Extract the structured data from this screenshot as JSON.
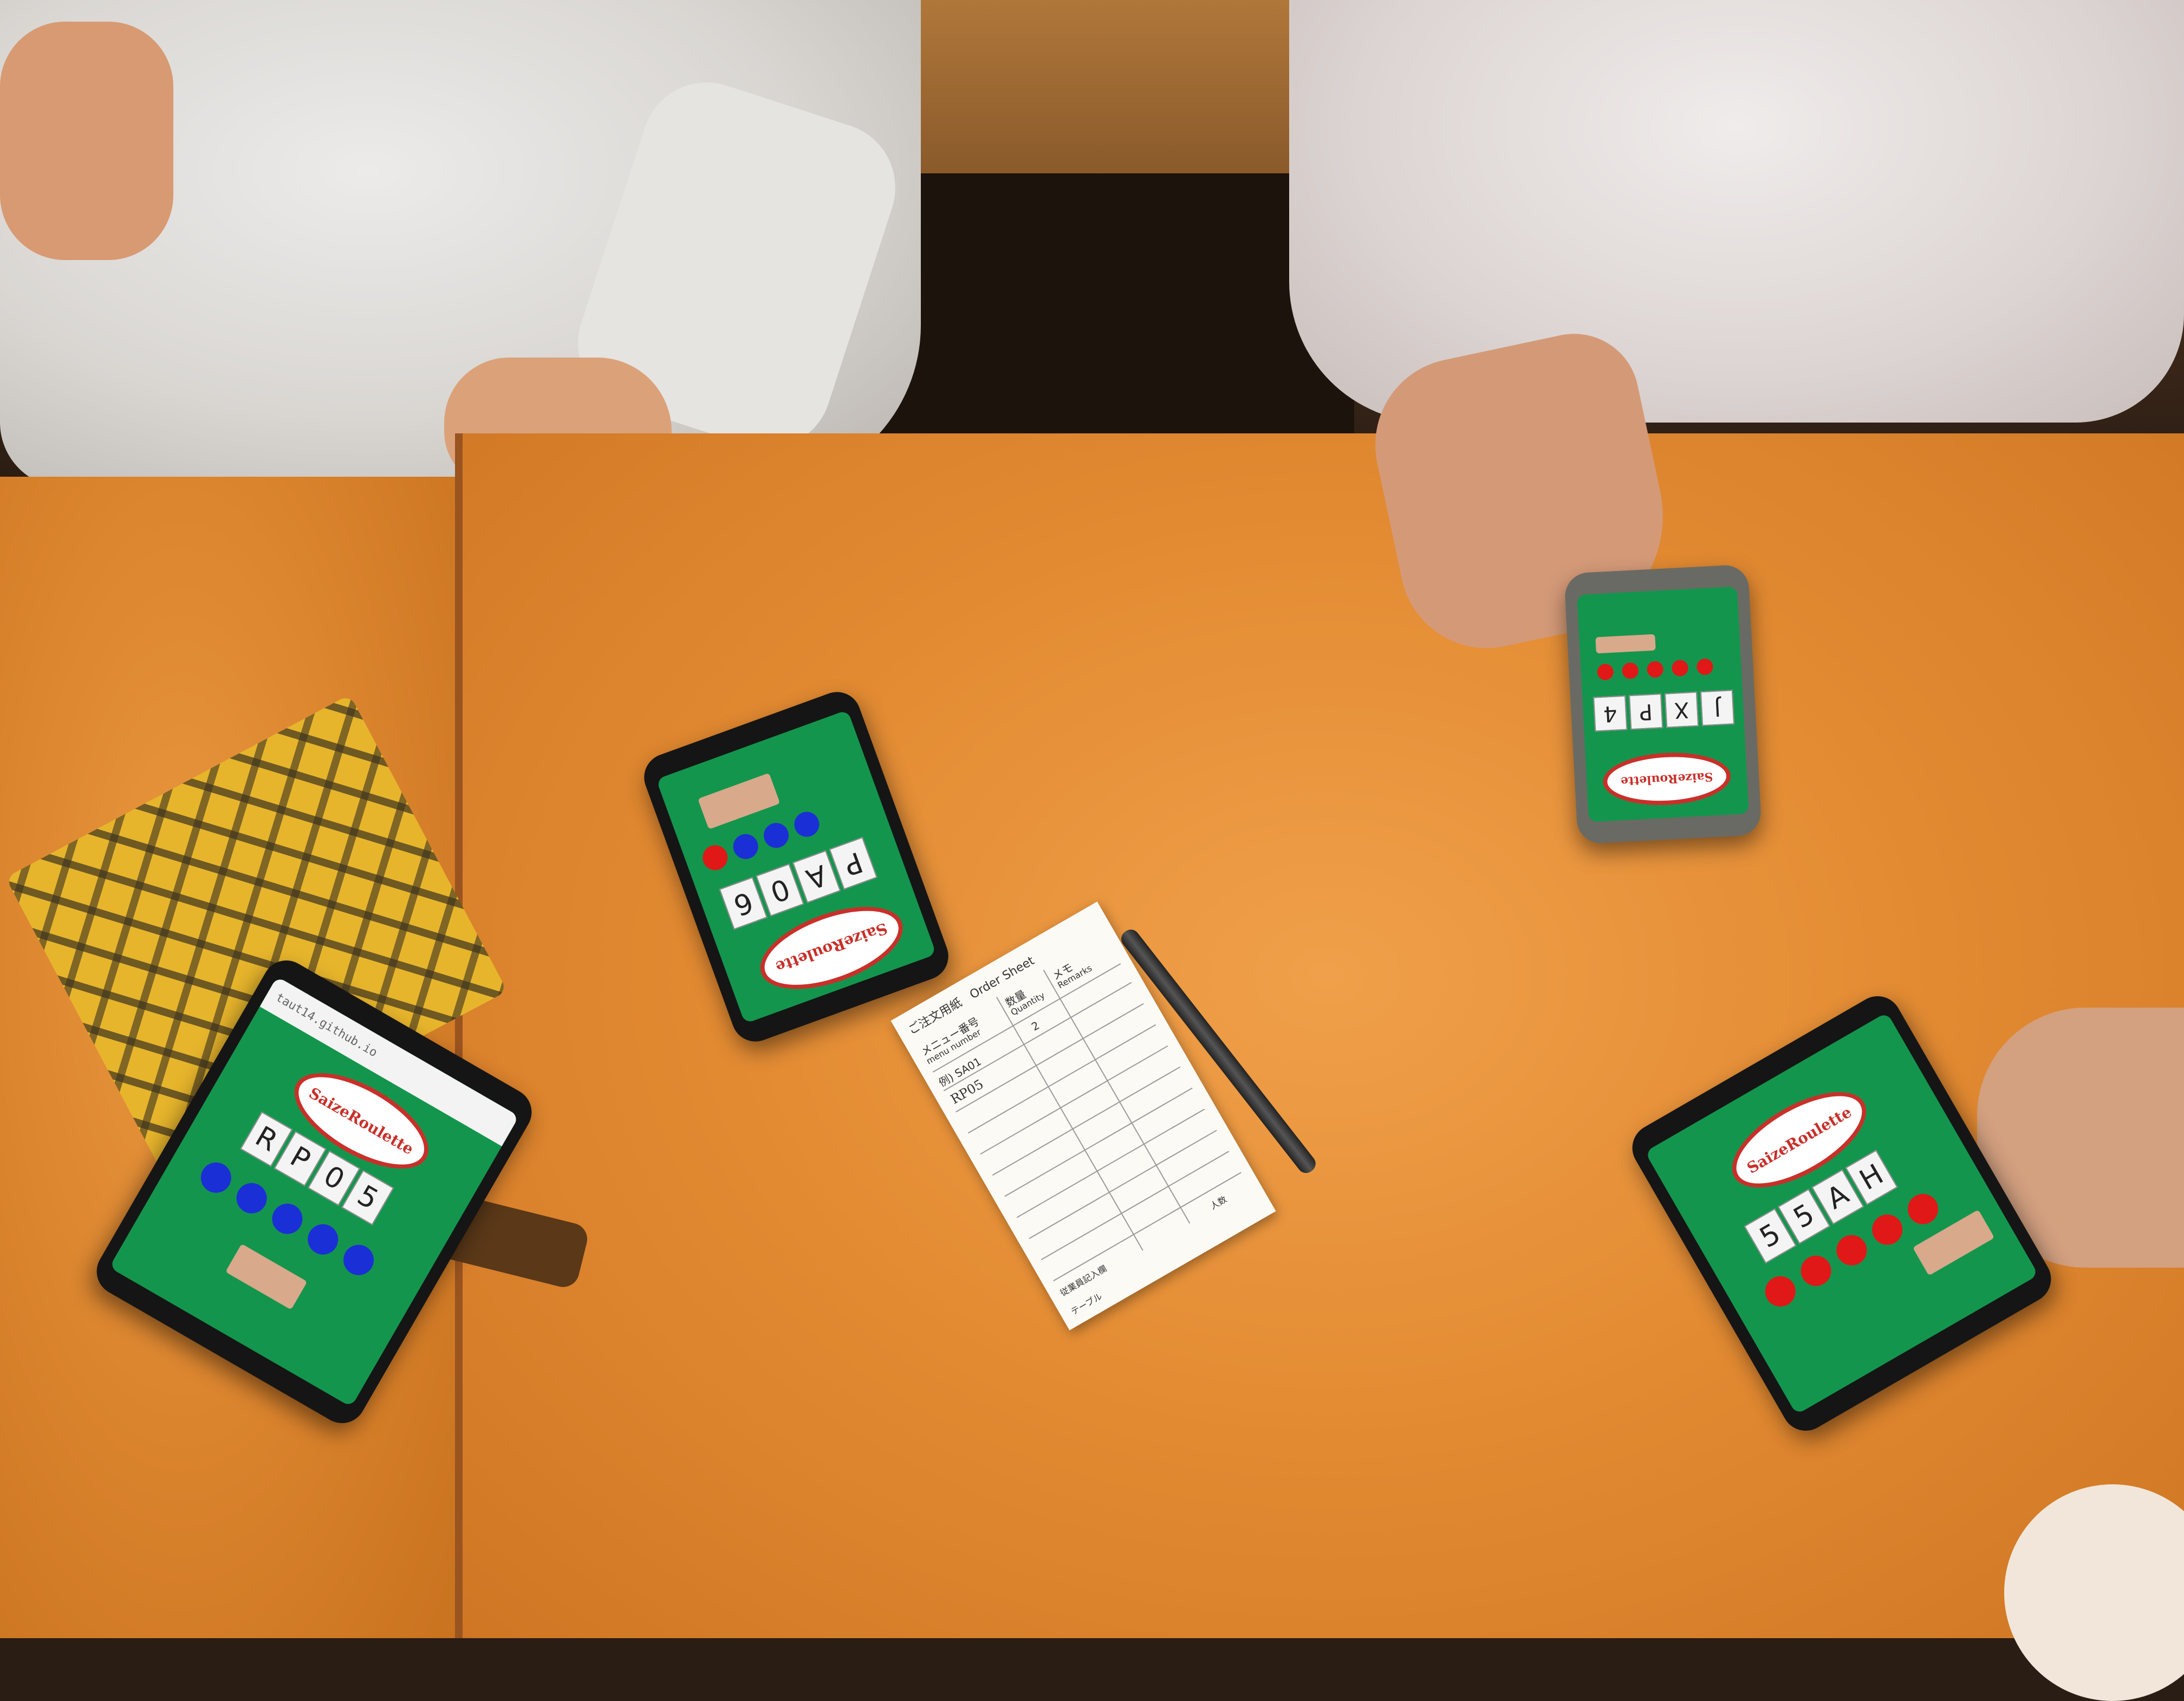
{
  "scene": {
    "colors": {
      "table": "#e28a32",
      "game_green": "#14954d",
      "dot_blue": "#1b2fd6",
      "dot_red": "#e01818",
      "logo_red": "#c8302a"
    }
  },
  "app": {
    "logo_text": "SaizeRoulette"
  },
  "phones": [
    {
      "id": "bottom-left",
      "url": "taut14.github.io",
      "code": [
        "R",
        "P",
        "0",
        "5"
      ],
      "dots": [
        "blue",
        "blue",
        "blue",
        "blue",
        "blue"
      ]
    },
    {
      "id": "center",
      "code": [
        "P",
        "A",
        "0",
        "6"
      ],
      "dots": [
        "red",
        "blue",
        "blue",
        "blue"
      ]
    },
    {
      "id": "top-right",
      "code": [
        "J",
        "X",
        "P",
        "4"
      ],
      "dots": [
        "red",
        "red",
        "red",
        "red",
        "red"
      ]
    },
    {
      "id": "bottom-right",
      "code": [
        "5",
        "5",
        "A",
        "H"
      ],
      "dots": [
        "red",
        "red",
        "red",
        "red",
        "red"
      ]
    }
  ],
  "order_sheet": {
    "title_ja": "ご注文用紙",
    "title_en": "Order Sheet",
    "col_menu_ja": "メニュー番号",
    "col_menu_en": "menu number",
    "col_qty_ja": "数量",
    "col_qty_en": "Quantity",
    "col_memo_ja": "メモ",
    "col_memo_en": "Remarks",
    "example_label": "例) SA01",
    "example_qty": "2",
    "handwritten": "RP05",
    "footer_staff": "従業員記入欄",
    "footer_people": "人数",
    "footer_table": "テーブル"
  }
}
